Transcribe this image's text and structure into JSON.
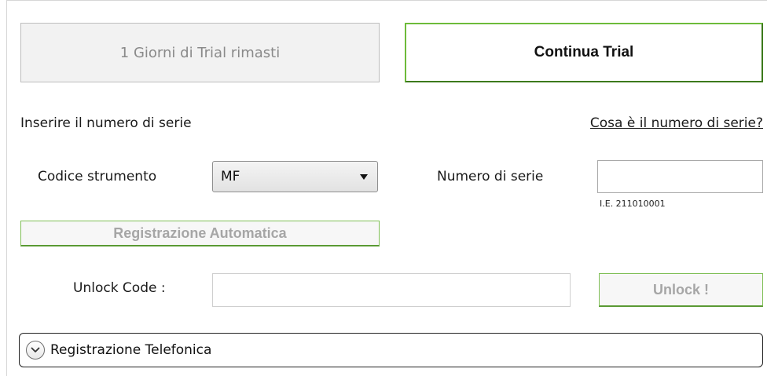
{
  "trial": {
    "days_left_label": "1 Giorni di Trial rimasti",
    "continue_label": "Continua Trial"
  },
  "serial": {
    "prompt": "Inserire il numero di serie",
    "help_link": "Cosa è il numero di serie?",
    "tool_code_label": "Codice strumento",
    "tool_code_value": "MF",
    "serial_label": "Numero di serie",
    "serial_value": "",
    "serial_example": "I.E. 211010001"
  },
  "registration": {
    "auto_label": "Registrazione Automatica",
    "unlock_code_label": "Unlock Code :",
    "unlock_code_value": "",
    "unlock_button": "Unlock !",
    "phone_label": "Registrazione Telefonica"
  },
  "icons": {
    "dropdown": "chevron-down-icon",
    "expander": "expand-chevron-icon"
  },
  "colors": {
    "accent_green": "#6dbb3a",
    "disabled_text": "#a6a6a6"
  }
}
